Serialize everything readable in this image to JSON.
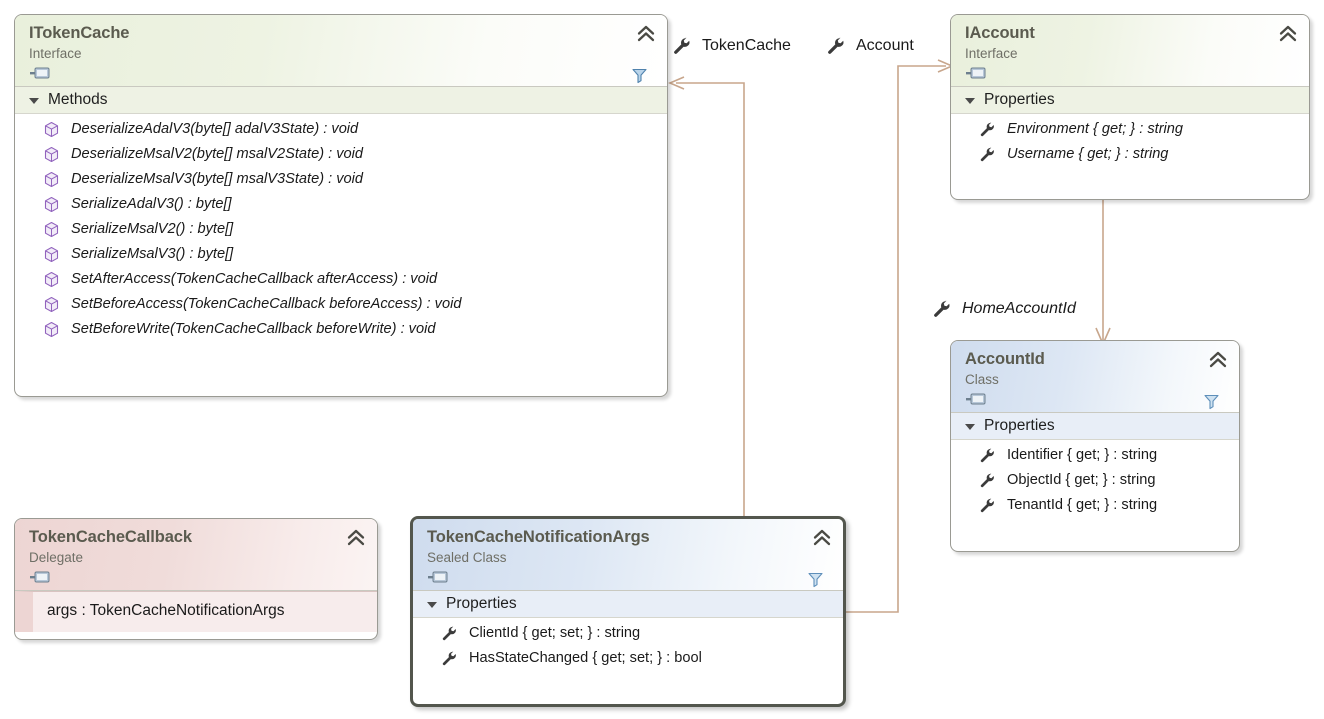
{
  "diagram": {
    "type": "uml-class-diagram",
    "background": "#ffffff",
    "connector_color": "#c8a68c"
  },
  "classes": [
    {
      "name": "ITokenCache",
      "stereotype": "Interface",
      "kind": "interface",
      "accent": "#e9f0dc",
      "compartments": [
        {
          "title": "Methods",
          "members": [
            {
              "icon": "method-icon",
              "text": "DeserializeAdalV3(byte[] adalV3State) : void"
            },
            {
              "icon": "method-icon",
              "text": "DeserializeMsalV2(byte[] msalV2State) : void"
            },
            {
              "icon": "method-icon",
              "text": "DeserializeMsalV3(byte[] msalV3State) : void"
            },
            {
              "icon": "method-icon",
              "text": "SerializeAdalV3() : byte[]"
            },
            {
              "icon": "method-icon",
              "text": "SerializeMsalV2() : byte[]"
            },
            {
              "icon": "method-icon",
              "text": "SerializeMsalV3() : byte[]"
            },
            {
              "icon": "method-icon",
              "text": "SetAfterAccess(TokenCacheCallback afterAccess) : void"
            },
            {
              "icon": "method-icon",
              "text": "SetBeforeAccess(TokenCacheCallback beforeAccess) : void"
            },
            {
              "icon": "method-icon",
              "text": "SetBeforeWrite(TokenCacheCallback beforeWrite) : void"
            }
          ]
        }
      ]
    },
    {
      "name": "IAccount",
      "stereotype": "Interface",
      "kind": "interface",
      "accent": "#e9f0dc",
      "compartments": [
        {
          "title": "Properties",
          "members": [
            {
              "icon": "property-icon",
              "text": "Environment { get; } : string"
            },
            {
              "icon": "property-icon",
              "text": "Username { get; } : string"
            }
          ]
        }
      ]
    },
    {
      "name": "AccountId",
      "stereotype": "Class",
      "kind": "class",
      "accent": "#cfdcee",
      "compartments": [
        {
          "title": "Properties",
          "members": [
            {
              "icon": "property-icon",
              "text": "Identifier { get; } : string"
            },
            {
              "icon": "property-icon",
              "text": "ObjectId { get; } : string"
            },
            {
              "icon": "property-icon",
              "text": "TenantId { get; } : string"
            }
          ]
        }
      ]
    },
    {
      "name": "TokenCacheCallback",
      "stereotype": "Delegate",
      "kind": "delegate",
      "accent": "#edd5d3",
      "signature": "args : TokenCacheNotificationArgs"
    },
    {
      "name": "TokenCacheNotificationArgs",
      "stereotype": "Sealed Class",
      "kind": "sealed-class",
      "accent": "#cfdcee",
      "selected": true,
      "compartments": [
        {
          "title": "Properties",
          "members": [
            {
              "icon": "property-icon",
              "text": "ClientId { get; set; } : string"
            },
            {
              "icon": "property-icon",
              "text": "HasStateChanged { get; set; } : bool"
            }
          ]
        }
      ]
    }
  ],
  "associations": [
    {
      "label": "TokenCache",
      "from": "TokenCacheNotificationArgs",
      "to": "ITokenCache",
      "italic": false
    },
    {
      "label": "Account",
      "from": "TokenCacheNotificationArgs",
      "to": "IAccount",
      "italic": false
    },
    {
      "label": "HomeAccountId",
      "from": "IAccount",
      "to": "AccountId",
      "italic": true
    }
  ]
}
